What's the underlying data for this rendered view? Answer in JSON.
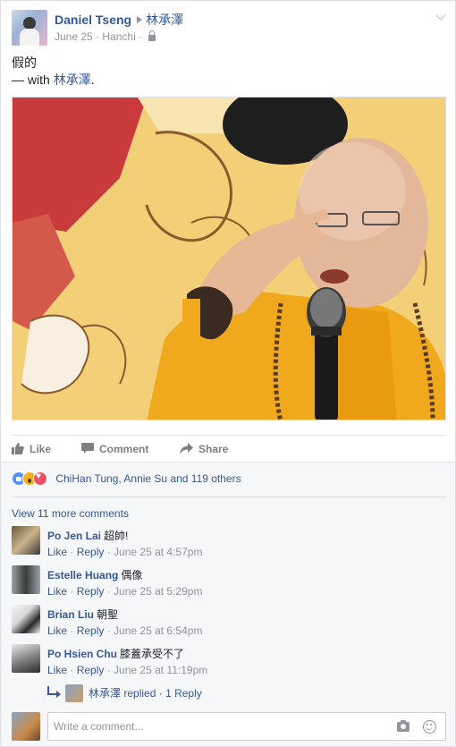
{
  "post": {
    "author": "Daniel Tseng",
    "tagged": "林承澤",
    "date": "June 25",
    "location": "Hanchi",
    "privacy_icon": "lock-icon",
    "text_line1": "假的",
    "text_with_prefix": "— with ",
    "text_with_name": "林承澤",
    "text_with_suffix": "."
  },
  "actions": {
    "like": "Like",
    "comment": "Comment",
    "share": "Share"
  },
  "reactions": {
    "types": [
      "like",
      "wow",
      "love"
    ],
    "summary": "ChiHan Tung, Annie Su and 119 others"
  },
  "view_more": "View 11 more comments",
  "comments": [
    {
      "name": "Po Jen Lai",
      "text": "超帥!",
      "like": "Like",
      "reply": "Reply",
      "time": "June 25 at 4:57pm"
    },
    {
      "name": "Estelle Huang",
      "text": "偶像",
      "like": "Like",
      "reply": "Reply",
      "time": "June 25 at 5:29pm"
    },
    {
      "name": "Brian Liu",
      "text": "朝聖",
      "like": "Like",
      "reply": "Reply",
      "time": "June 25 at 6:54pm"
    },
    {
      "name": "Po Hsien Chu",
      "text": "膝蓋承受不了",
      "like": "Like",
      "reply": "Reply",
      "time": "June 25 at 11:19pm"
    }
  ],
  "reply_summary": {
    "name": "林承澤",
    "action": "replied",
    "count": "1 Reply"
  },
  "composer": {
    "placeholder": "Write a comment..."
  },
  "colors": {
    "link": "#365899",
    "meta": "#90949c",
    "robe": "#f0a81c"
  }
}
